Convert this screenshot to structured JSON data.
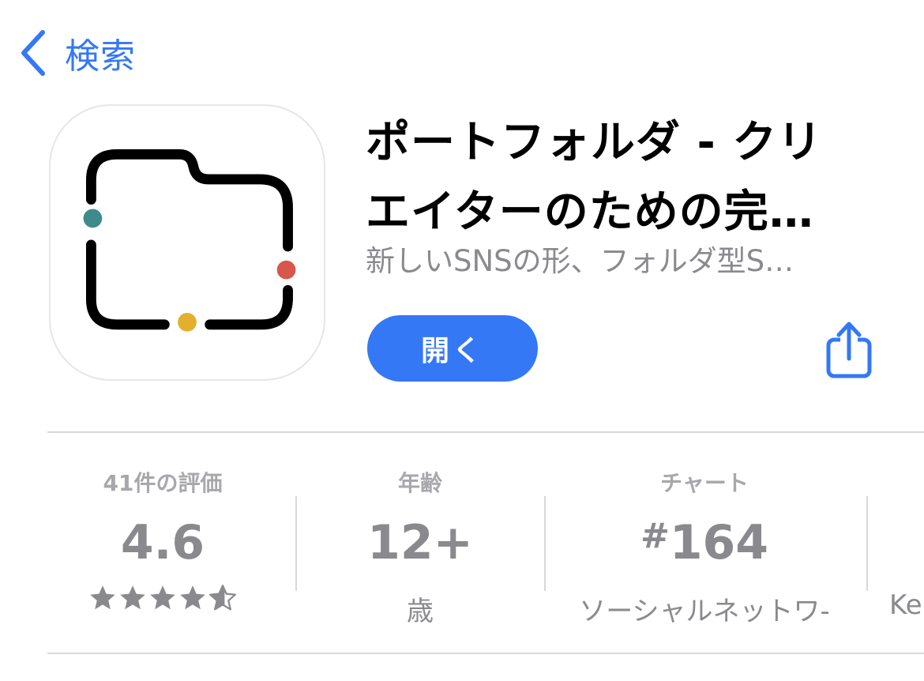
{
  "nav": {
    "back_label": "検索"
  },
  "app": {
    "title_line1": "ポートフォルダ - クリ",
    "title_line2": "エイターのための完…",
    "subtitle": "新しいSNSの形、フォルダ型S…",
    "open_label": "開く"
  },
  "stats": {
    "ratings": {
      "label": "41件の評価",
      "value": "4.6",
      "stars": 4.6
    },
    "age": {
      "label": "年齢",
      "value": "12+",
      "sub": "歳"
    },
    "chart": {
      "label": "チャート",
      "hash": "#",
      "value": "164",
      "sub": "ソーシャルネットワ-"
    },
    "developer": {
      "sub": "Ke"
    }
  },
  "colors": {
    "accent": "#3478f6",
    "icon_dot_teal": "#3f8a8c",
    "icon_dot_red": "#d9574a",
    "icon_dot_yellow": "#e2b02e",
    "stat_gray": "#8a8a8e"
  },
  "icons": [
    "chevron-left-icon",
    "share-icon",
    "star-icon"
  ]
}
